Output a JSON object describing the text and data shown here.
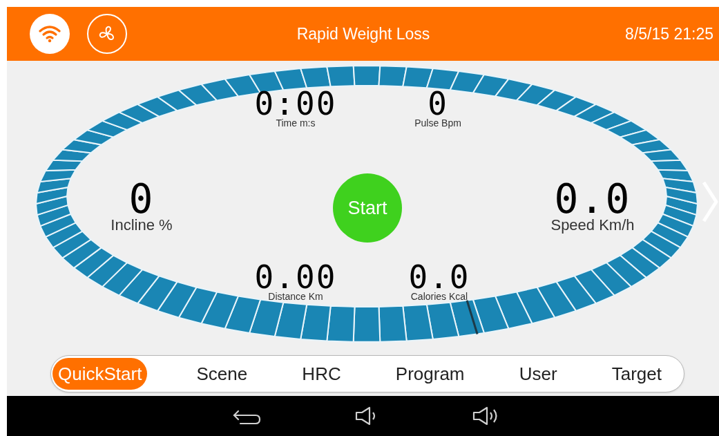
{
  "header": {
    "title": "Rapid Weight Loss",
    "datetime": "8/5/15 21:25"
  },
  "readings": [
    {
      "kind": "small",
      "value": "0:00",
      "label": "Time m:s"
    },
    {
      "kind": "small",
      "value": "0",
      "label": "Pulse Bpm"
    },
    {
      "kind": "large",
      "value": "0",
      "label": "Incline %"
    },
    {
      "kind": "large",
      "value": "0.0",
      "label": "Speed Km/h"
    },
    {
      "kind": "small",
      "value": "0.00",
      "label": "Distance Km"
    },
    {
      "kind": "small",
      "value": "0.0",
      "label": "Calories Kcal"
    }
  ],
  "start_button": {
    "label": "Start"
  },
  "tabs": [
    {
      "label": "QuickStart",
      "selected": true
    },
    {
      "label": "Scene",
      "selected": false
    },
    {
      "label": "HRC",
      "selected": false
    },
    {
      "label": "Program",
      "selected": false
    },
    {
      "label": "User",
      "selected": false
    },
    {
      "label": "Target",
      "selected": false
    }
  ]
}
